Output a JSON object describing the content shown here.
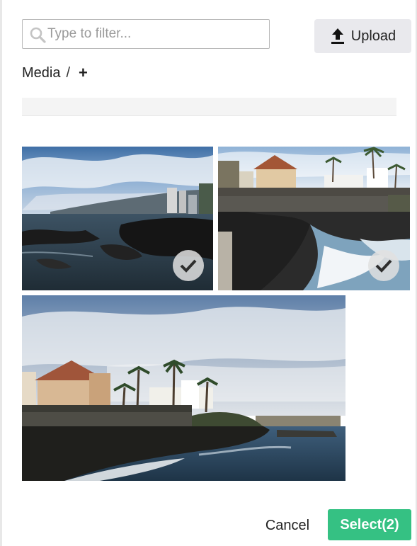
{
  "filter": {
    "placeholder": "Type to filter...",
    "value": ""
  },
  "upload": {
    "label": "Upload",
    "icon": "upload-icon"
  },
  "breadcrumb": {
    "root": "Media",
    "separator": "/",
    "add_label": "+"
  },
  "media": {
    "items": [
      {
        "name": "coast-rocks-city",
        "selected": true
      },
      {
        "name": "coast-buildings-waves",
        "selected": true
      },
      {
        "name": "coast-buildings-palms",
        "selected": false
      }
    ]
  },
  "footer": {
    "cancel_label": "Cancel",
    "select_label": "Select(2)"
  },
  "colors": {
    "accent": "#35c183",
    "upload_bg": "#e9e9ed",
    "input_border": "#b9b9b9"
  }
}
